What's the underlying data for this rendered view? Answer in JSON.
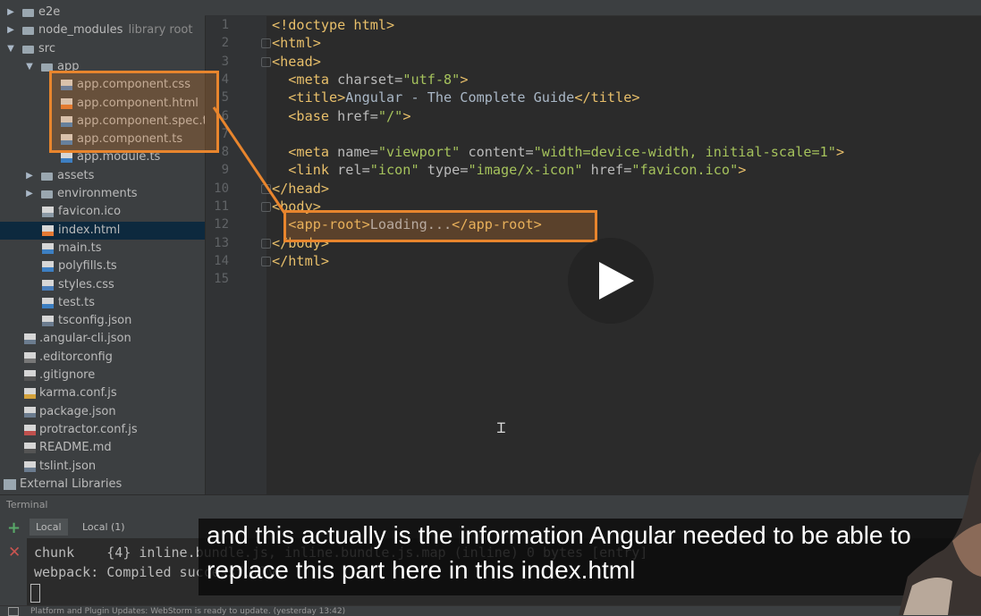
{
  "project_tree": {
    "items": [
      {
        "label": "e2e",
        "type": "folder",
        "arrow": "▶",
        "indent": 0
      },
      {
        "label": "node_modules",
        "hint": "library root",
        "type": "folder",
        "arrow": "▶",
        "indent": 0
      },
      {
        "label": "src",
        "type": "folder",
        "arrow": "▼",
        "indent": 0
      },
      {
        "label": "app",
        "type": "folder",
        "arrow": "▼",
        "indent": 1
      },
      {
        "label": "app.component.css",
        "type": "file",
        "badge": "CSS",
        "indent": 2
      },
      {
        "label": "app.component.html",
        "type": "file",
        "badge": "HTML",
        "indent": 2
      },
      {
        "label": "app.component.spec.ts",
        "type": "file",
        "badge": "TS",
        "indent": 2
      },
      {
        "label": "app.component.ts",
        "type": "file",
        "badge": "TS",
        "indent": 2
      },
      {
        "label": "app.module.ts",
        "type": "file",
        "badge": "TS",
        "indent": 2
      },
      {
        "label": "assets",
        "type": "folder",
        "arrow": "▶",
        "indent": 1
      },
      {
        "label": "environments",
        "type": "folder",
        "arrow": "▶",
        "indent": 1
      },
      {
        "label": "favicon.ico",
        "type": "file",
        "badge": "ICO",
        "indent": 1
      },
      {
        "label": "index.html",
        "type": "file",
        "badge": "HTML",
        "indent": 1,
        "selected": true
      },
      {
        "label": "main.ts",
        "type": "file",
        "badge": "TS",
        "indent": 1
      },
      {
        "label": "polyfills.ts",
        "type": "file",
        "badge": "TS",
        "indent": 1
      },
      {
        "label": "styles.css",
        "type": "file",
        "badge": "CSS",
        "indent": 1
      },
      {
        "label": "test.ts",
        "type": "file",
        "badge": "TS",
        "indent": 1
      },
      {
        "label": "tsconfig.json",
        "type": "file",
        "badge": "JSON",
        "indent": 1
      },
      {
        "label": ".angular-cli.json",
        "type": "file",
        "badge": "JSON",
        "indent": 0
      },
      {
        "label": ".editorconfig",
        "type": "file",
        "badge": "CFG",
        "indent": 0
      },
      {
        "label": ".gitignore",
        "type": "file",
        "badge": "GIT",
        "indent": 0
      },
      {
        "label": "karma.conf.js",
        "type": "file",
        "badge": "JS",
        "indent": 0
      },
      {
        "label": "package.json",
        "type": "file",
        "badge": "JSON",
        "indent": 0
      },
      {
        "label": "protractor.conf.js",
        "type": "file",
        "badge": "PROT",
        "indent": 0
      },
      {
        "label": "README.md",
        "type": "file",
        "badge": "MD",
        "indent": 0
      },
      {
        "label": "tslint.json",
        "type": "file",
        "badge": "JSON",
        "indent": 0
      },
      {
        "label": "External Libraries",
        "type": "library",
        "indent": -1
      }
    ]
  },
  "editor": {
    "line_numbers": [
      "1",
      "2",
      "3",
      "4",
      "5",
      "6",
      "7",
      "8",
      "9",
      "10",
      "11",
      "12",
      "13",
      "14",
      "15"
    ],
    "lines": [
      [
        {
          "t": "<!doctype html>",
          "c": "tag"
        }
      ],
      [
        {
          "t": "<html>",
          "c": "tag"
        }
      ],
      [
        {
          "t": "<head>",
          "c": "tag"
        }
      ],
      [
        {
          "t": "  <meta ",
          "c": "tag"
        },
        {
          "t": "charset=",
          "c": "attr"
        },
        {
          "t": "\"utf-8\"",
          "c": "str"
        },
        {
          "t": ">",
          "c": "tag"
        }
      ],
      [
        {
          "t": "  <title>",
          "c": "tag"
        },
        {
          "t": "Angular - The Complete Guide",
          "c": "txt"
        },
        {
          "t": "</title>",
          "c": "tag"
        }
      ],
      [
        {
          "t": "  <base ",
          "c": "tag"
        },
        {
          "t": "href=",
          "c": "attr"
        },
        {
          "t": "\"/\"",
          "c": "str"
        },
        {
          "t": ">",
          "c": "tag"
        }
      ],
      [],
      [
        {
          "t": "  <meta ",
          "c": "tag"
        },
        {
          "t": "name=",
          "c": "attr"
        },
        {
          "t": "\"viewport\" ",
          "c": "str"
        },
        {
          "t": "content=",
          "c": "attr"
        },
        {
          "t": "\"width=device-width, initial-scale=1\"",
          "c": "str"
        },
        {
          "t": ">",
          "c": "tag"
        }
      ],
      [
        {
          "t": "  <link ",
          "c": "tag"
        },
        {
          "t": "rel=",
          "c": "attr"
        },
        {
          "t": "\"icon\" ",
          "c": "str"
        },
        {
          "t": "type=",
          "c": "attr"
        },
        {
          "t": "\"image/x-icon\" ",
          "c": "str"
        },
        {
          "t": "href=",
          "c": "attr"
        },
        {
          "t": "\"favicon.ico\"",
          "c": "str"
        },
        {
          "t": ">",
          "c": "tag"
        }
      ],
      [
        {
          "t": "</head>",
          "c": "tag"
        }
      ],
      [
        {
          "t": "<body>",
          "c": "tag"
        }
      ],
      [
        {
          "t": "  <app-root>",
          "c": "tag"
        },
        {
          "t": "Loading...",
          "c": "txt"
        },
        {
          "t": "</app-root>",
          "c": "tag"
        }
      ],
      [
        {
          "t": "</body>",
          "c": "tag"
        }
      ],
      [
        {
          "t": "</html>",
          "c": "tag"
        }
      ],
      []
    ]
  },
  "terminal": {
    "title": "Terminal",
    "tabs": [
      "Local",
      "Local (1)"
    ],
    "lines": [
      "chunk    {4} inline.bundle.js, inline.bundle.js.map (inline) 0 bytes [entry]",
      "webpack: Compiled successfully."
    ]
  },
  "status_bar": {
    "message": "Platform and Plugin Updates: WebStorm is ready to update. (yesterday 13:42)"
  },
  "subtitle": {
    "line1": "and this actually is the information Angular needed to be able to",
    "line2": "replace this part here in this index.html"
  },
  "colors": {
    "highlight": "#e8852d",
    "tag": "#e8bf6a",
    "string": "#a5c25c",
    "attr": "#bababa"
  }
}
